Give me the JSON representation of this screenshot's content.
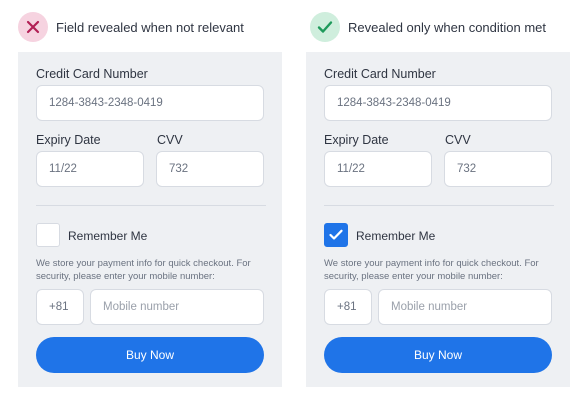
{
  "colors": {
    "accent": "#1f74e8",
    "bad_badge_bg": "#f6d3e0",
    "bad_icon": "#b21f55",
    "good_badge_bg": "#cfeedd",
    "good_icon": "#1e9a5b",
    "panel_bg": "#eef0f3"
  },
  "examples": [
    {
      "header": {
        "icon": "close-icon",
        "label": "Field revealed when not relevant"
      },
      "form": {
        "card_number_label": "Credit Card Number",
        "card_number_value": "1284-3843-2348-0419",
        "expiry_label": "Expiry Date",
        "expiry_value": "11/22",
        "cvv_label": "CVV",
        "cvv_value": "732",
        "remember_label": "Remember Me",
        "remember_checked": false,
        "note_text": "We store your payment info for quick checkout. For security, please enter your mobile number:",
        "country_code": "+81",
        "mobile_placeholder": "Mobile number",
        "buy_label": "Buy Now"
      }
    },
    {
      "header": {
        "icon": "checkmark-icon",
        "label": "Revealed only when condition met"
      },
      "form": {
        "card_number_label": "Credit Card Number",
        "card_number_value": "1284-3843-2348-0419",
        "expiry_label": "Expiry Date",
        "expiry_value": "11/22",
        "cvv_label": "CVV",
        "cvv_value": "732",
        "remember_label": "Remember Me",
        "remember_checked": true,
        "note_text": "We store your payment info for quick checkout. For security, please enter your mobile number:",
        "country_code": "+81",
        "mobile_placeholder": "Mobile number",
        "buy_label": "Buy Now"
      }
    }
  ]
}
